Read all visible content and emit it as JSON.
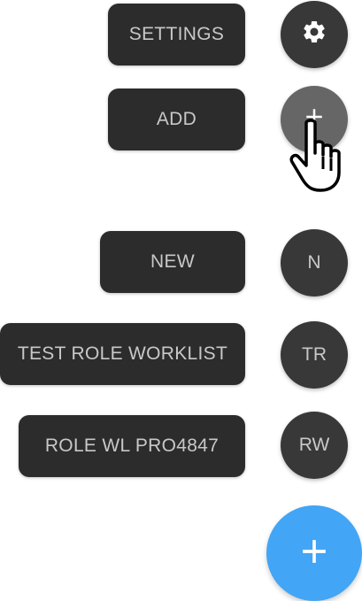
{
  "actions": [
    {
      "label": "SETTINGS",
      "icon": "gear-icon"
    },
    {
      "label": "ADD",
      "icon": "plus-icon"
    },
    {
      "label": "NEW",
      "initials": "N"
    },
    {
      "label": "TEST ROLE WORKLIST",
      "initials": "TR"
    },
    {
      "label": "ROLE WL PRO4847",
      "initials": "RW"
    }
  ],
  "main_fab": {
    "icon": "plus-icon",
    "color": "#42a5f5"
  },
  "colors": {
    "chip_bg": "#2c2c2c",
    "mini_fab_bg": "#383838",
    "mini_fab_hover_bg": "#666666",
    "text": "#c8c8c8"
  },
  "cursor": {
    "icon": "hand-pointer-icon"
  }
}
